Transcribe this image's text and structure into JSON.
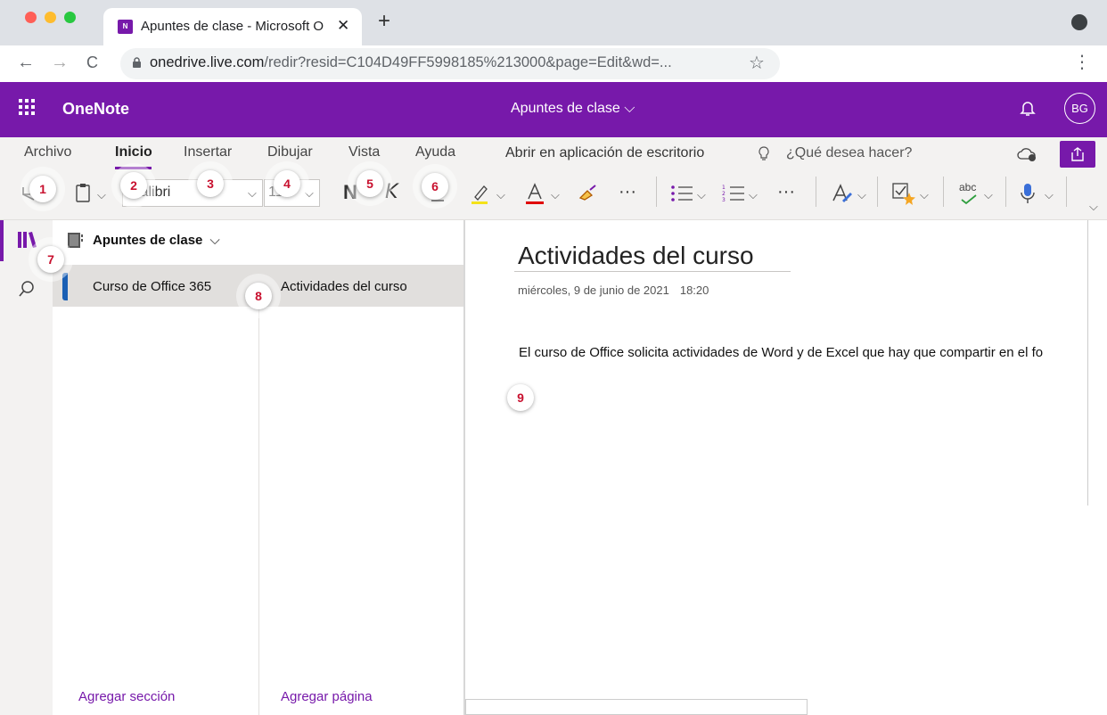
{
  "browser": {
    "tab_title": "Apuntes de clase - Microsoft O",
    "tab_favicon": "N",
    "close_glyph": "✕",
    "new_tab_glyph": "+",
    "back_glyph": "←",
    "forward_glyph": "→",
    "reload_glyph": "C",
    "url_host": "onedrive.live.com",
    "url_path": "/redir?resid=C104D49FF5998185%213000&page=Edit&wd=...",
    "star_glyph": "☆",
    "menu_glyph": "⋮",
    "traffic_colors": [
      "#ff5f57",
      "#febc2e",
      "#28c840"
    ]
  },
  "header": {
    "app_name": "OneNote",
    "notebook_title": "Apuntes de clase ⌵",
    "avatar": "BG",
    "accent_color": "#7719aa"
  },
  "ribbon": {
    "tabs": [
      "Archivo",
      "Inicio",
      "Insertar",
      "Dibujar",
      "Vista",
      "Ayuda"
    ],
    "active_tab": "Inicio",
    "open_desktop": "Abrir en aplicación de escritorio",
    "tell_me": "¿Qué desea hacer?",
    "font_name": "Calibri",
    "font_size": "11",
    "bold": "N",
    "italic": "K",
    "underline": "S",
    "more": "···",
    "spell_label": "abc"
  },
  "callouts": [
    "1",
    "2",
    "3",
    "4",
    "5",
    "6",
    "7",
    "8",
    "9"
  ],
  "navigation": {
    "notebook": "Apuntes de clase",
    "section": "Curso de Office 365",
    "page": "Actividades del curso",
    "add_section": "Agregar sección",
    "add_page": "Agregar página"
  },
  "page": {
    "title": "Actividades del curso",
    "date": "miércoles, 9 de junio de 2021",
    "time": "18:20",
    "body": "El curso de Office solicita actividades de Word y de Excel que hay que compartir en el fo"
  },
  "icons": [
    "undo-icon",
    "clipboard-icon",
    "bold-icon",
    "italic-icon",
    "underline-icon",
    "highlighter-icon",
    "font-color-icon",
    "format-painter-icon",
    "bullet-list-icon",
    "numbered-list-icon",
    "styles-icon",
    "todo-tag-icon",
    "spelling-icon",
    "dictate-icon",
    "library-icon",
    "search-icon",
    "bell-icon",
    "share-icon",
    "cloud-sync-icon",
    "lightbulb-icon"
  ]
}
